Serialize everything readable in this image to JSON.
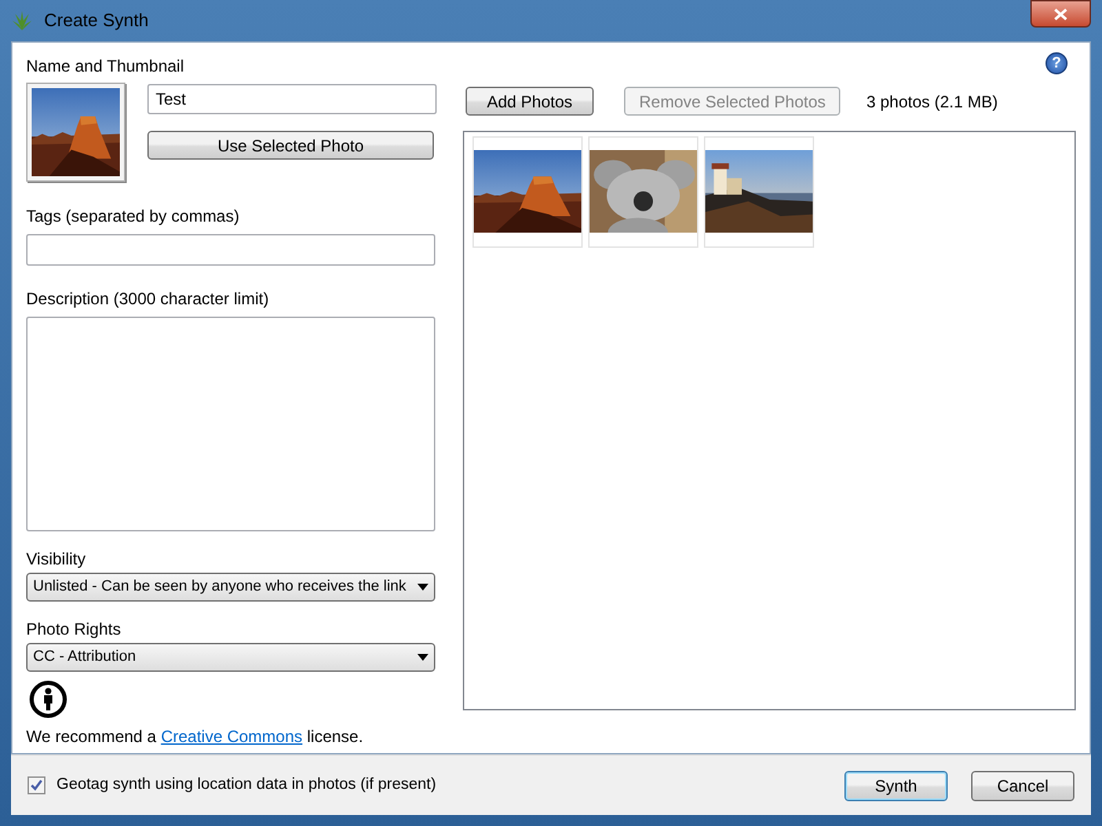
{
  "window": {
    "title": "Create Synth",
    "help": "?"
  },
  "name_section": {
    "label": "Name and Thumbnail",
    "name_value": "Test",
    "use_photo_button": "Use Selected Photo"
  },
  "tags": {
    "label": "Tags (separated by commas)"
  },
  "description": {
    "label": "Description (3000 character limit)"
  },
  "visibility": {
    "label": "Visibility",
    "value": "Unlisted - Can be seen by anyone who receives the link"
  },
  "photo_rights": {
    "label": "Photo Rights",
    "value": "CC - Attribution"
  },
  "license_note": {
    "before": "We recommend a ",
    "link": "Creative Commons",
    "after": " license."
  },
  "photo_toolbar": {
    "buttons": [
      {
        "label": "Add Photos",
        "disabled": false
      },
      {
        "label": "Remove Selected Photos",
        "disabled": true
      }
    ],
    "count": "3 photos (2.1 MB)"
  },
  "photos": [
    {
      "kind": "desert"
    },
    {
      "kind": "koala"
    },
    {
      "kind": "lighthouse"
    }
  ],
  "footer": {
    "geotag": {
      "label": "Geotag synth using location data in photos (if present)",
      "checked": true
    },
    "buttons": [
      {
        "label": "Synth",
        "default": true
      },
      {
        "label": "Cancel",
        "default": false
      }
    ]
  }
}
